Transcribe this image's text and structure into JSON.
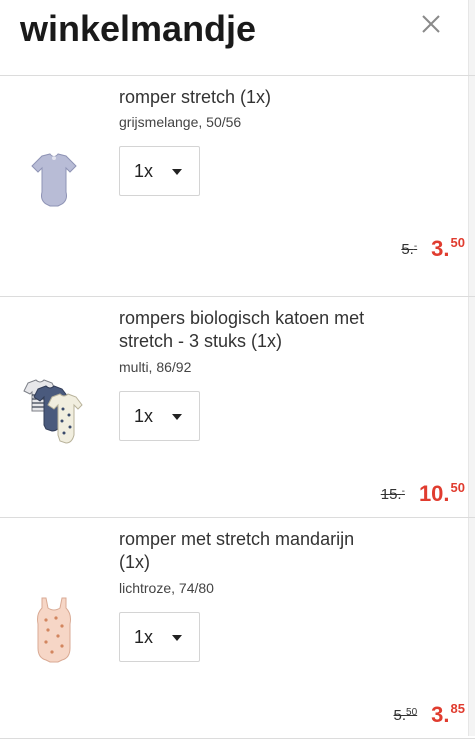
{
  "header": {
    "title": "winkelmandje"
  },
  "icons": {
    "close": "close-icon",
    "caret": "chevron-down-icon"
  },
  "colors": {
    "sale_price": "#e03c2f",
    "divider": "#dcdcdc"
  },
  "items": [
    {
      "name": "romper stretch (1x)",
      "variant": "grijsmelange, 50/56",
      "quantity": "1x",
      "old_price_int": "5.",
      "old_price_dec": "-",
      "new_price_int": "3.",
      "new_price_dec": "50"
    },
    {
      "name": "rompers biologisch katoen met stretch - 3 stuks (1x)",
      "variant": "multi, 86/92",
      "quantity": "1x",
      "old_price_int": "15.",
      "old_price_dec": "-",
      "new_price_int": "10.",
      "new_price_dec": "50"
    },
    {
      "name": "romper met stretch mandarijn (1x)",
      "variant": "lichtroze, 74/80",
      "quantity": "1x",
      "old_price_int": "5.",
      "old_price_dec": "50",
      "new_price_int": "3.",
      "new_price_dec": "85"
    }
  ]
}
